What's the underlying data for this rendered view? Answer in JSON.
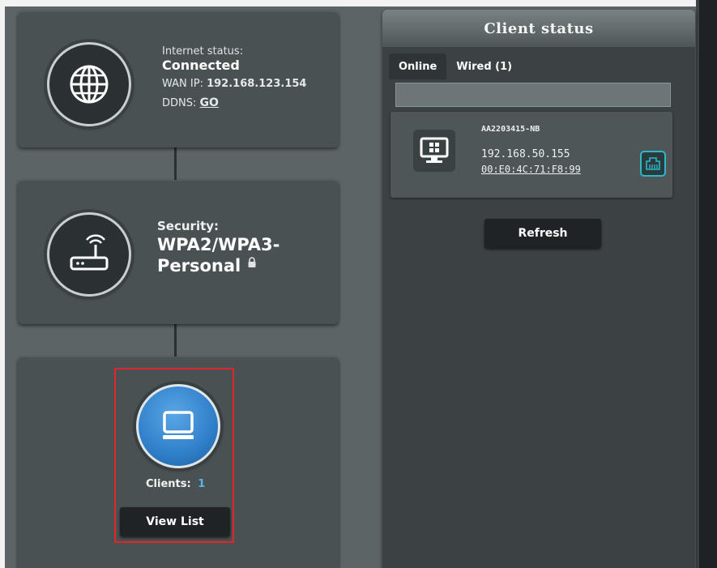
{
  "internet": {
    "status_label": "Internet status:",
    "status_value": "Connected",
    "wan_ip_label": "WAN IP:",
    "wan_ip_value": "192.168.123.154",
    "ddns_label": "DDNS:",
    "ddns_link": "GO",
    "icon": "globe-icon"
  },
  "security": {
    "label": "Security:",
    "value_line1": "WPA2/WPA3-",
    "value_line2": "Personal",
    "icon": "router-icon",
    "lock_icon": "lock-icon"
  },
  "clients": {
    "label": "Clients:",
    "count": "1",
    "button_label": "View List",
    "icon": "monitor-icon"
  },
  "client_status": {
    "title": "Client status",
    "tabs": [
      {
        "label": "Online",
        "active": true
      },
      {
        "label": "Wired (1)",
        "active": false
      }
    ],
    "search_placeholder": "",
    "client": {
      "name": "AA2203415-NB",
      "ip": "192.168.50.155",
      "mac": "00:E0:4C:71:F8:99",
      "os_icon": "windows-desktop-icon",
      "connection_icon": "ethernet-icon"
    },
    "refresh_label": "Refresh"
  },
  "colors": {
    "background": "#5d6466",
    "card": "#4a5153",
    "panel": "#3c4244",
    "highlight": "#e0262b",
    "accent_cyan": "#2fb6c7",
    "clients_circle": "#2f7fc9"
  }
}
